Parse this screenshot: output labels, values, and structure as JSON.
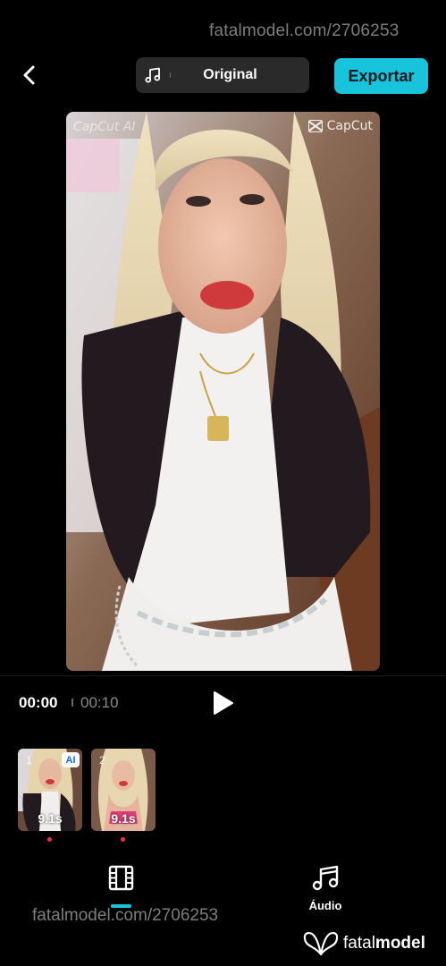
{
  "watermark": {
    "top_text": "fatalmodel.com/2706253",
    "bottom_text": "fatalmodel.com/2706253"
  },
  "header": {
    "back_icon": "chevron-left-icon",
    "audio_selector": {
      "icon": "music-note-icon",
      "label": "Original"
    },
    "export_label": "Exportar"
  },
  "preview": {
    "top_left_mark": "CapCut AI",
    "top_right_mark": "CapCut"
  },
  "playback": {
    "current_time": "00:00",
    "total_time": "00:10",
    "play_icon": "play-icon"
  },
  "clips": [
    {
      "index": "1",
      "duration": "9.1s",
      "badge": "AI"
    },
    {
      "index": "2",
      "duration": "9.1s",
      "badge": ""
    }
  ],
  "bottom_tabs": {
    "video_tab_icon": "film-strip-icon",
    "audio_tab_icon": "music-notes-icon",
    "audio_label": "Áudio"
  },
  "brand": {
    "name_part1": "fatal",
    "name_part2": "model"
  },
  "colors": {
    "background": "#000000",
    "accent": "#18c3dc",
    "pill": "#2a2a2a",
    "clip_marker": "#e8344a"
  }
}
